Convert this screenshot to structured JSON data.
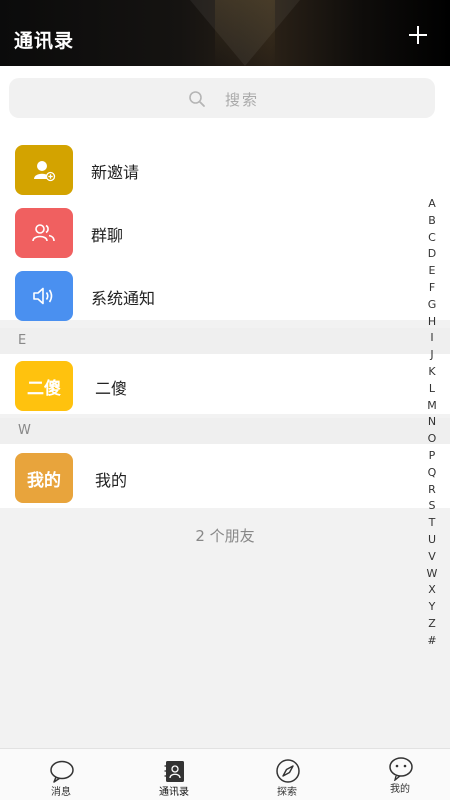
{
  "header": {
    "title": "通讯录"
  },
  "search": {
    "placeholder": "搜索"
  },
  "functions": [
    {
      "label": "新邀请",
      "color": "#d3a300"
    },
    {
      "label": "群聊",
      "color": "#f06060"
    },
    {
      "label": "系统通知",
      "color": "#4a90f0"
    }
  ],
  "sections": [
    {
      "letter": "E",
      "contact": {
        "name": "二傻",
        "avatar_text": "二傻",
        "color": "#ffc20e"
      }
    },
    {
      "letter": "W",
      "contact": {
        "name": "我的",
        "avatar_text": "我的",
        "color": "#e8a43c"
      }
    }
  ],
  "friend_count": "2 个朋友",
  "index_letters": [
    "A",
    "B",
    "C",
    "D",
    "E",
    "F",
    "G",
    "H",
    "I",
    "J",
    "K",
    "L",
    "M",
    "N",
    "O",
    "P",
    "Q",
    "R",
    "S",
    "T",
    "U",
    "V",
    "W",
    "X",
    "Y",
    "Z",
    "#"
  ],
  "tabs": [
    {
      "label": "消息",
      "icon": "chat-bubble-icon"
    },
    {
      "label": "通讯录",
      "icon": "contacts-icon"
    },
    {
      "label": "探索",
      "icon": "compass-icon"
    },
    {
      "label": "我的",
      "icon": "smiley-bubble-icon"
    }
  ]
}
